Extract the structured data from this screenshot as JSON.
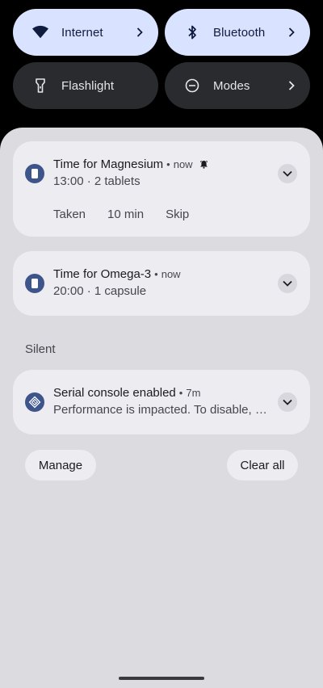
{
  "quick_settings": {
    "internet": {
      "label": "Internet",
      "icon": "wifi-icon",
      "state": "on"
    },
    "bluetooth": {
      "label": "Bluetooth",
      "icon": "bluetooth-icon",
      "state": "on"
    },
    "flashlight": {
      "label": "Flashlight",
      "icon": "flashlight-icon",
      "state": "off"
    },
    "modes": {
      "label": "Modes",
      "icon": "modes-icon",
      "state": "off"
    }
  },
  "notifications": [
    {
      "title": "Time for Magnesium",
      "separator": "•",
      "time": "now",
      "text": "13:00 · 2 tablets",
      "icon": "pill-icon",
      "alert_icon": "bell-icon",
      "actions": [
        "Taken",
        "10 min",
        "Skip"
      ]
    },
    {
      "title": "Time for Omega-3",
      "separator": "•",
      "time": "now",
      "text": "20:00 · 1 capsule",
      "icon": "pill-icon"
    }
  ],
  "silent_section": {
    "label": "Silent",
    "notifications": [
      {
        "title": "Serial console enabled",
        "separator": "•",
        "time": "7m",
        "text": "Performance is impacted. To disable, check bootloader.",
        "icon": "settings-diamond-icon"
      }
    ]
  },
  "footer": {
    "manage_label": "Manage",
    "clear_all_label": "Clear all"
  },
  "colors": {
    "tile_active": "#d9e2ff",
    "tile_inactive": "#2a2b2f",
    "shade_background": "#dcdbe0",
    "card_background": "#edecf1",
    "app_icon": "#3d558b"
  }
}
